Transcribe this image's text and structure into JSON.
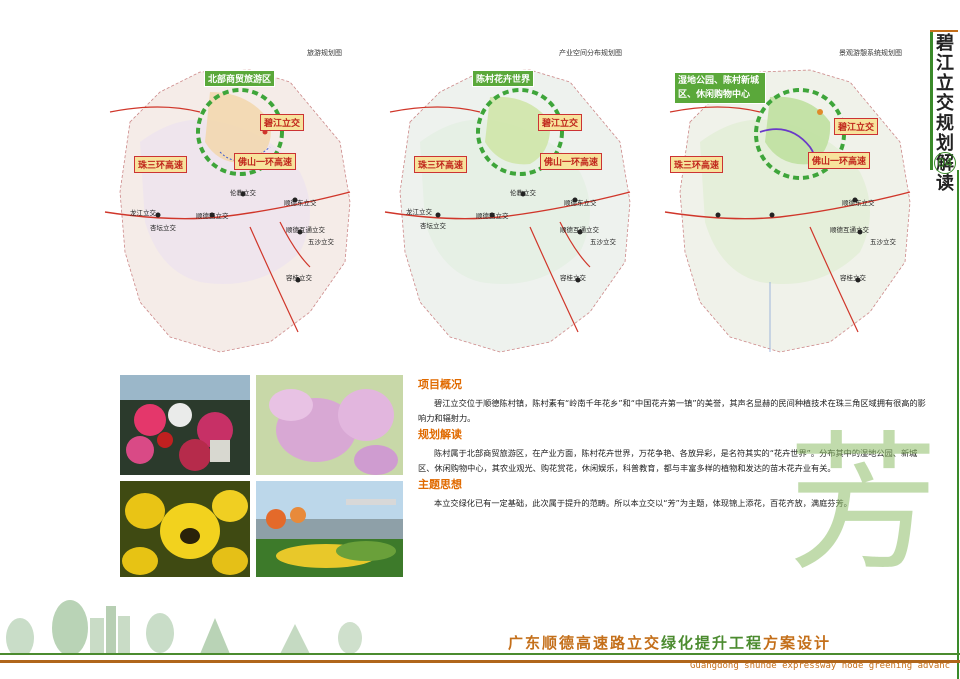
{
  "side": {
    "title": "碧江立交规划解读",
    "page_no": "04"
  },
  "maps": [
    {
      "title": "旅游规划图",
      "labels": {
        "top": "北部商贸旅游区",
        "right": "碧江立交",
        "left": "珠三环高速",
        "mid": "佛山一环高速"
      }
    },
    {
      "title": "产业空间分布规划图",
      "labels": {
        "top": "陈村花卉世界",
        "right": "碧江立交",
        "left": "珠三环高速",
        "mid": "佛山一环高速"
      }
    },
    {
      "title": "景观游憩系统规划图",
      "labels": {
        "top": "湿地公园、陈村新城区、休闲购物中心",
        "right": "碧江立交",
        "left": "珠三环高速",
        "mid": "佛山一环高速"
      }
    }
  ],
  "nodes": {
    "longjiang": "龙江立交",
    "xingtan": "杏坛立交",
    "shundexi": "顺德西立交",
    "lunjiao": "伦教立交",
    "shundedong": "顺德东立交",
    "shundehutong": "顺德互通立交",
    "wushalijiao": "五沙立交",
    "ronggui": "容桂立交"
  },
  "sections": [
    {
      "title": "项目概况",
      "body": "碧江立交位于顺德陈村镇，陈村素有“岭南千年花乡”和“中国花卉第一镇”的美誉，其声名显赫的民间种植技术在珠三角区域拥有很高的影响力和辐射力。"
    },
    {
      "title": "规划解读",
      "body": "陈村属于北部商贸旅游区，在产业方面，陈村花卉世界，万花争艳、各放异彩，是名符其实的“花卉世界”。分布其中的湿地公园、新城区、休闲购物中心，其农业观光、购花赏花，休闲娱乐，科普教育，都与丰富多样的植物和发达的苗木花卉业有关。"
    },
    {
      "title": "主题思想",
      "body": "本立交绿化已有一定基础，此次属于提升的范畴。所以本立交以“芳”为主题，体现锦上添花，百花齐放，满庭芬芳。"
    }
  ],
  "big_char": "芳",
  "footer": {
    "title_a": "广东顺德高速路立交",
    "title_b": "绿化提升工程",
    "title_c": "方案设计",
    "subtitle": "Guangdong shunde expressway node greening advanc"
  },
  "colors": {
    "accent_green": "#4b8b2f",
    "accent_orange": "#c46f1a",
    "road_red": "#d0362a"
  }
}
